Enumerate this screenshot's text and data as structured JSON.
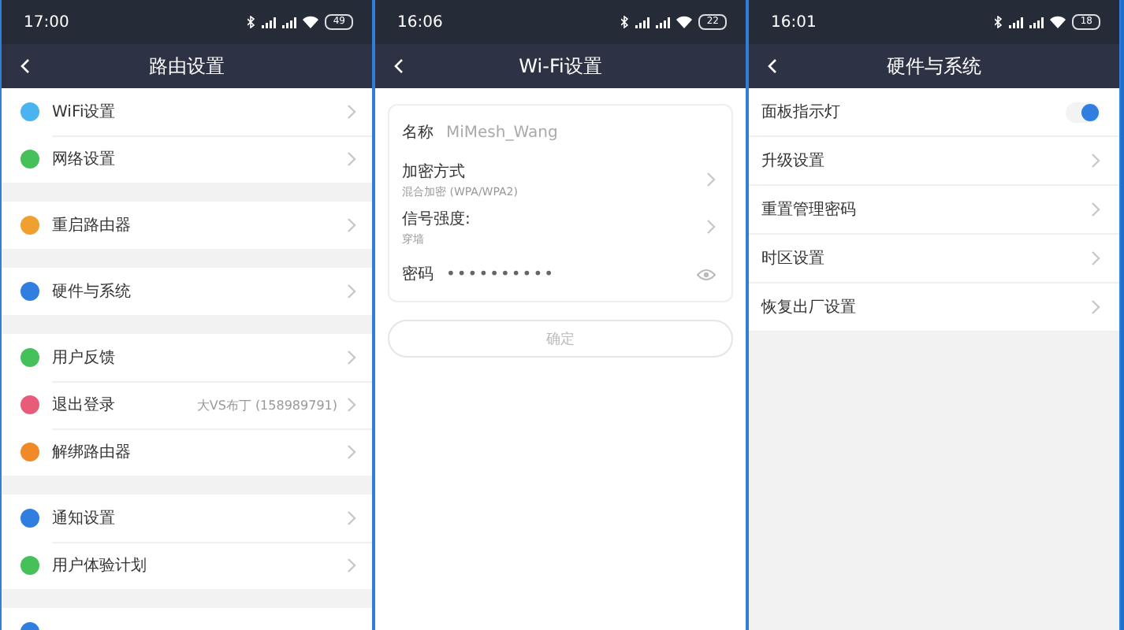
{
  "screens": [
    {
      "kind": "menu",
      "status_bar": {
        "time": "17:00",
        "battery": "49"
      },
      "title": "路由设置",
      "groups": [
        [
          {
            "label": "WiFi设置",
            "color": "#4ab3f0"
          },
          {
            "label": "网络设置",
            "color": "#46c15a"
          }
        ],
        [
          {
            "label": "重启路由器",
            "color": "#f0a030"
          }
        ],
        [
          {
            "label": "硬件与系统",
            "color": "#2f7ee0"
          }
        ],
        [
          {
            "label": "用户反馈",
            "color": "#46c15a"
          },
          {
            "label": "退出登录",
            "color": "#e85c7a",
            "value": "大VS布丁 (158989791)"
          },
          {
            "label": "解绑路由器",
            "color": "#f08a28"
          }
        ],
        [
          {
            "label": "通知设置",
            "color": "#2f7ee0"
          },
          {
            "label": "用户体验计划",
            "color": "#46c15a"
          }
        ],
        [
          {
            "color": "#2f7ee0"
          }
        ]
      ]
    },
    {
      "kind": "form",
      "status_bar": {
        "time": "16:06",
        "battery": "22"
      },
      "title": "Wi-Fi设置",
      "fields": [
        {
          "kind": "text",
          "label": "名称",
          "value": "MiMesh_Wang"
        },
        {
          "kind": "select",
          "label": "加密方式",
          "value": "混合加密 (WPA/WPA2)"
        },
        {
          "kind": "select",
          "label": "信号强度:",
          "value": "穿墙"
        },
        {
          "kind": "password",
          "label": "密码",
          "value": "••••••••••"
        }
      ],
      "button": {
        "label": "确定",
        "disabled": true
      }
    },
    {
      "kind": "settings",
      "status_bar": {
        "time": "16:01",
        "battery": "18"
      },
      "title": "硬件与系统",
      "items": [
        {
          "kind": "toggle",
          "label": "面板指示灯",
          "on": true
        },
        {
          "kind": "link",
          "label": "升级设置"
        },
        {
          "kind": "link",
          "label": "重置管理密码"
        },
        {
          "kind": "link",
          "label": "时区设置"
        },
        {
          "kind": "link",
          "label": "恢复出厂设置"
        }
      ]
    }
  ]
}
